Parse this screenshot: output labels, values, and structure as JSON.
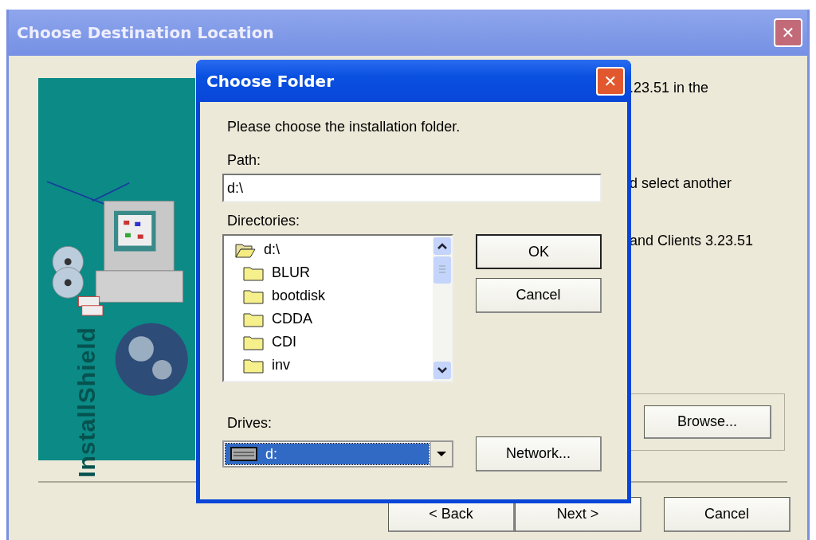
{
  "window": {
    "title": "Choose Destination Location",
    "close_label": "✕"
  },
  "banner": {
    "text": "InstallShield"
  },
  "body_texts": [
    ".23.51 in the",
    "d select another",
    "and Clients 3.23.51"
  ],
  "browse_button": "Browse...",
  "buttons": [
    {
      "label": "< Back",
      "kind": "back"
    },
    {
      "label": "Next >",
      "kind": "next"
    },
    {
      "label": "Cancel",
      "kind": "cancel"
    }
  ],
  "dialog": {
    "title": "Choose Folder",
    "close_label": "✕",
    "prompt": "Please choose the installation folder.",
    "path_label": "Path:",
    "path_value": "d:\\",
    "directories_label": "Directories:",
    "directories": [
      {
        "name": "d:\\",
        "open": true
      },
      {
        "name": "BLUR",
        "open": false
      },
      {
        "name": "bootdisk",
        "open": false
      },
      {
        "name": "CDDA",
        "open": false
      },
      {
        "name": "CDI",
        "open": false
      },
      {
        "name": "inv",
        "open": false
      }
    ],
    "ok_button": "OK",
    "cancel_button": "Cancel",
    "drives_label": "Drives:",
    "drive_value": "d:",
    "network_button": "Network..."
  }
}
